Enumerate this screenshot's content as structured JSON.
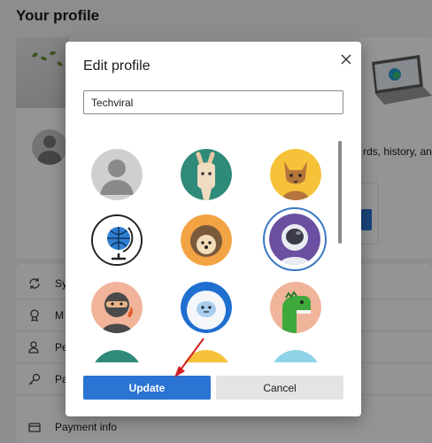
{
  "background": {
    "page_title": "Your profile",
    "sync_text": "rds, history, and",
    "settings_rows": [
      {
        "label": "Sy",
        "icon": "sync-icon"
      },
      {
        "label": "M",
        "icon": "rewards-icon"
      },
      {
        "label": "Pe",
        "icon": "personal-info-icon"
      },
      {
        "label": "Pa",
        "icon": "key-icon"
      },
      {
        "label": "Payment info",
        "icon": "card-icon"
      }
    ]
  },
  "dialog": {
    "title": "Edit profile",
    "name_value": "Techviral",
    "close_icon": "close-icon",
    "avatars": [
      "default-person",
      "llama",
      "cat",
      "globe",
      "hedgehog",
      "astronaut",
      "ninja",
      "yeti",
      "dinosaur"
    ],
    "selected_avatar": "astronaut",
    "update_label": "Update",
    "cancel_label": "Cancel"
  },
  "colors": {
    "accent": "#2b74d3",
    "arrow": "#d32020",
    "selection_ring": "#3b78c4"
  }
}
